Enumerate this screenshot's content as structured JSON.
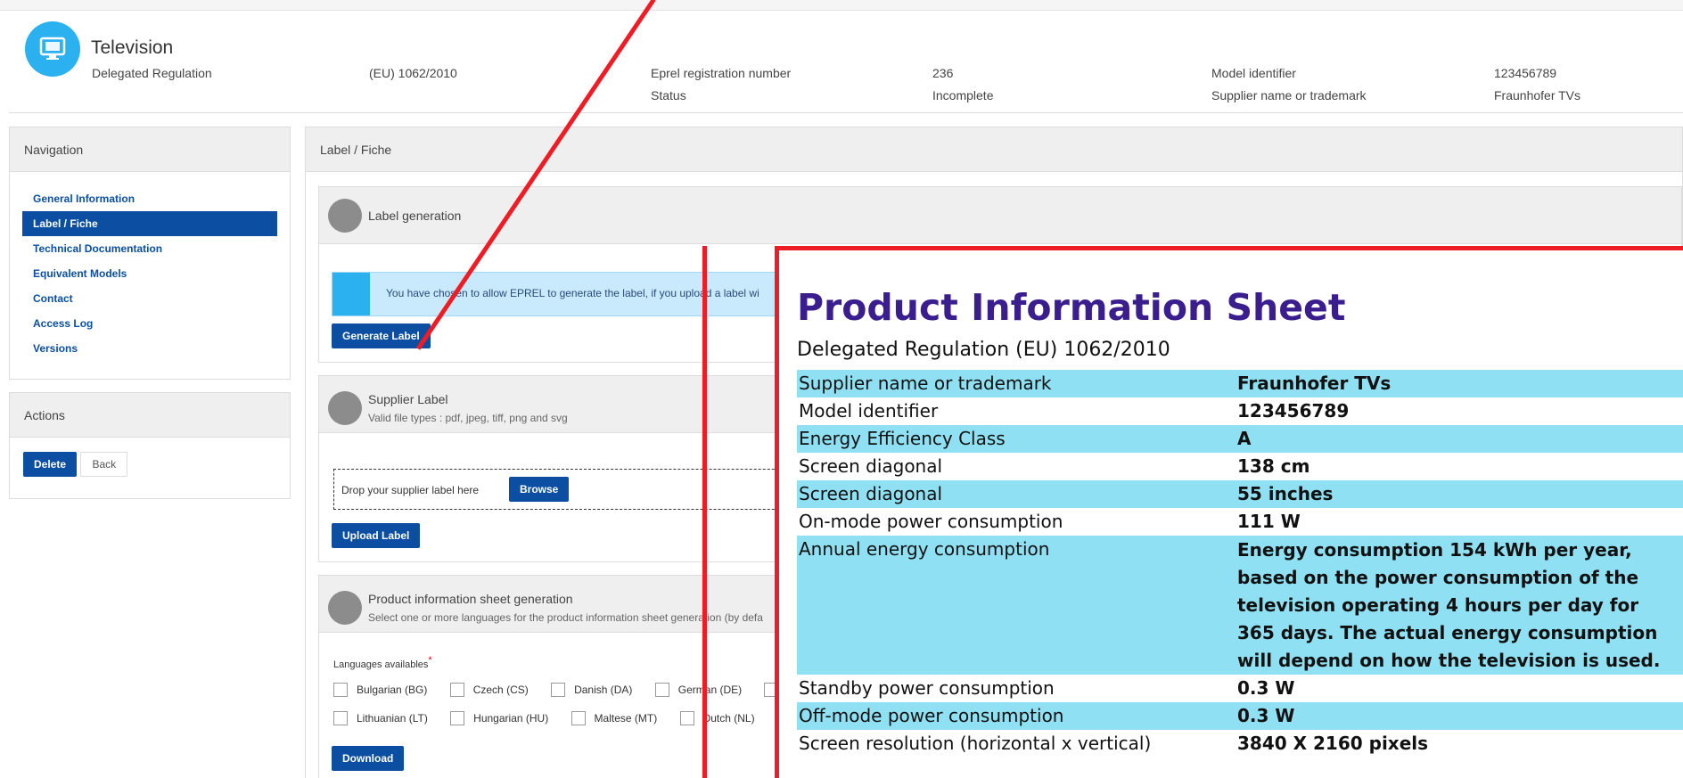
{
  "header": {
    "product_title": "Television",
    "icon": "monitor-icon",
    "fields": [
      {
        "label": "Delegated Regulation",
        "value": "(EU) 1062/2010"
      },
      {
        "label": "Eprel registration number",
        "value": "236"
      },
      {
        "label": "Status",
        "value": "Incomplete"
      },
      {
        "label": "Model identifier",
        "value": "123456789"
      },
      {
        "label": "Supplier name or trademark",
        "value": "Fraunhofer TVs"
      }
    ]
  },
  "navigation": {
    "title": "Navigation",
    "items": [
      {
        "label": "General Information",
        "active": false
      },
      {
        "label": "Label / Fiche",
        "active": true
      },
      {
        "label": "Technical Documentation",
        "active": false
      },
      {
        "label": "Equivalent Models",
        "active": false
      },
      {
        "label": "Contact",
        "active": false
      },
      {
        "label": "Access Log",
        "active": false
      },
      {
        "label": "Versions",
        "active": false
      }
    ]
  },
  "actions": {
    "title": "Actions",
    "delete_label": "Delete",
    "back_label": "Back"
  },
  "main": {
    "title": "Label / Fiche",
    "label_generation": {
      "title": "Label generation",
      "info": "You have chosen to allow EPREL to generate the label, if you upload a label wi",
      "button": "Generate Label"
    },
    "supplier_label": {
      "title": "Supplier Label",
      "subtitle": "Valid file types : pdf, jpeg, tiff, png and svg",
      "drop_text": "Drop your supplier label here",
      "browse": "Browse",
      "upload": "Upload Label"
    },
    "pis_generation": {
      "title": "Product information sheet generation",
      "subtitle": "Select one or more languages for the product information sheet generation (by defa",
      "languages_label": "Languages availables",
      "required_mark": "*",
      "languages_row1": [
        "Bulgarian (BG)",
        "Czech (CS)",
        "Danish (DA)",
        "German (DE)",
        ""
      ],
      "languages_row2": [
        "Lithuanian (LT)",
        "Hungarian (HU)",
        "Maltese (MT)",
        "Dutch (NL)",
        ""
      ],
      "download": "Download"
    }
  },
  "sheet": {
    "title": "Product Information Sheet",
    "regulation": "Delegated Regulation (EU) 1062/2010",
    "rows": [
      {
        "label": "Supplier name or trademark",
        "value": "Fraunhofer TVs",
        "shaded": true
      },
      {
        "label": "Model identifier",
        "value": "123456789",
        "shaded": false
      },
      {
        "label": "Energy Efficiency Class",
        "value": "A",
        "shaded": true
      },
      {
        "label": "Screen diagonal",
        "value": "138 cm",
        "shaded": false
      },
      {
        "label": "Screen diagonal",
        "value": "55 inches",
        "shaded": true
      },
      {
        "label": "On-mode power consumption",
        "value": "111 W",
        "shaded": false
      },
      {
        "label": "Annual energy consumption",
        "value": "Energy consumption 154 kWh per year,  based on the power consumption of the television operating 4 hours per day for 365 days. The actual energy consumption will depend on how the television is used.",
        "shaded": true
      },
      {
        "label": "Standby power consumption",
        "value": "0.3 W",
        "shaded": false
      },
      {
        "label": "Off-mode power consumption",
        "value": "0.3 W",
        "shaded": true
      },
      {
        "label": "Screen resolution (horizontal x vertical)",
        "value": "3840 X 2160 pixels",
        "shaded": false
      }
    ]
  },
  "colors": {
    "accent": "#0b4ea2",
    "icon_bg": "#2bb0f0",
    "annotation_red": "#ee1c25",
    "sheet_title": "#3b1e8e",
    "sheet_row_shade": "#8fe0f2"
  }
}
